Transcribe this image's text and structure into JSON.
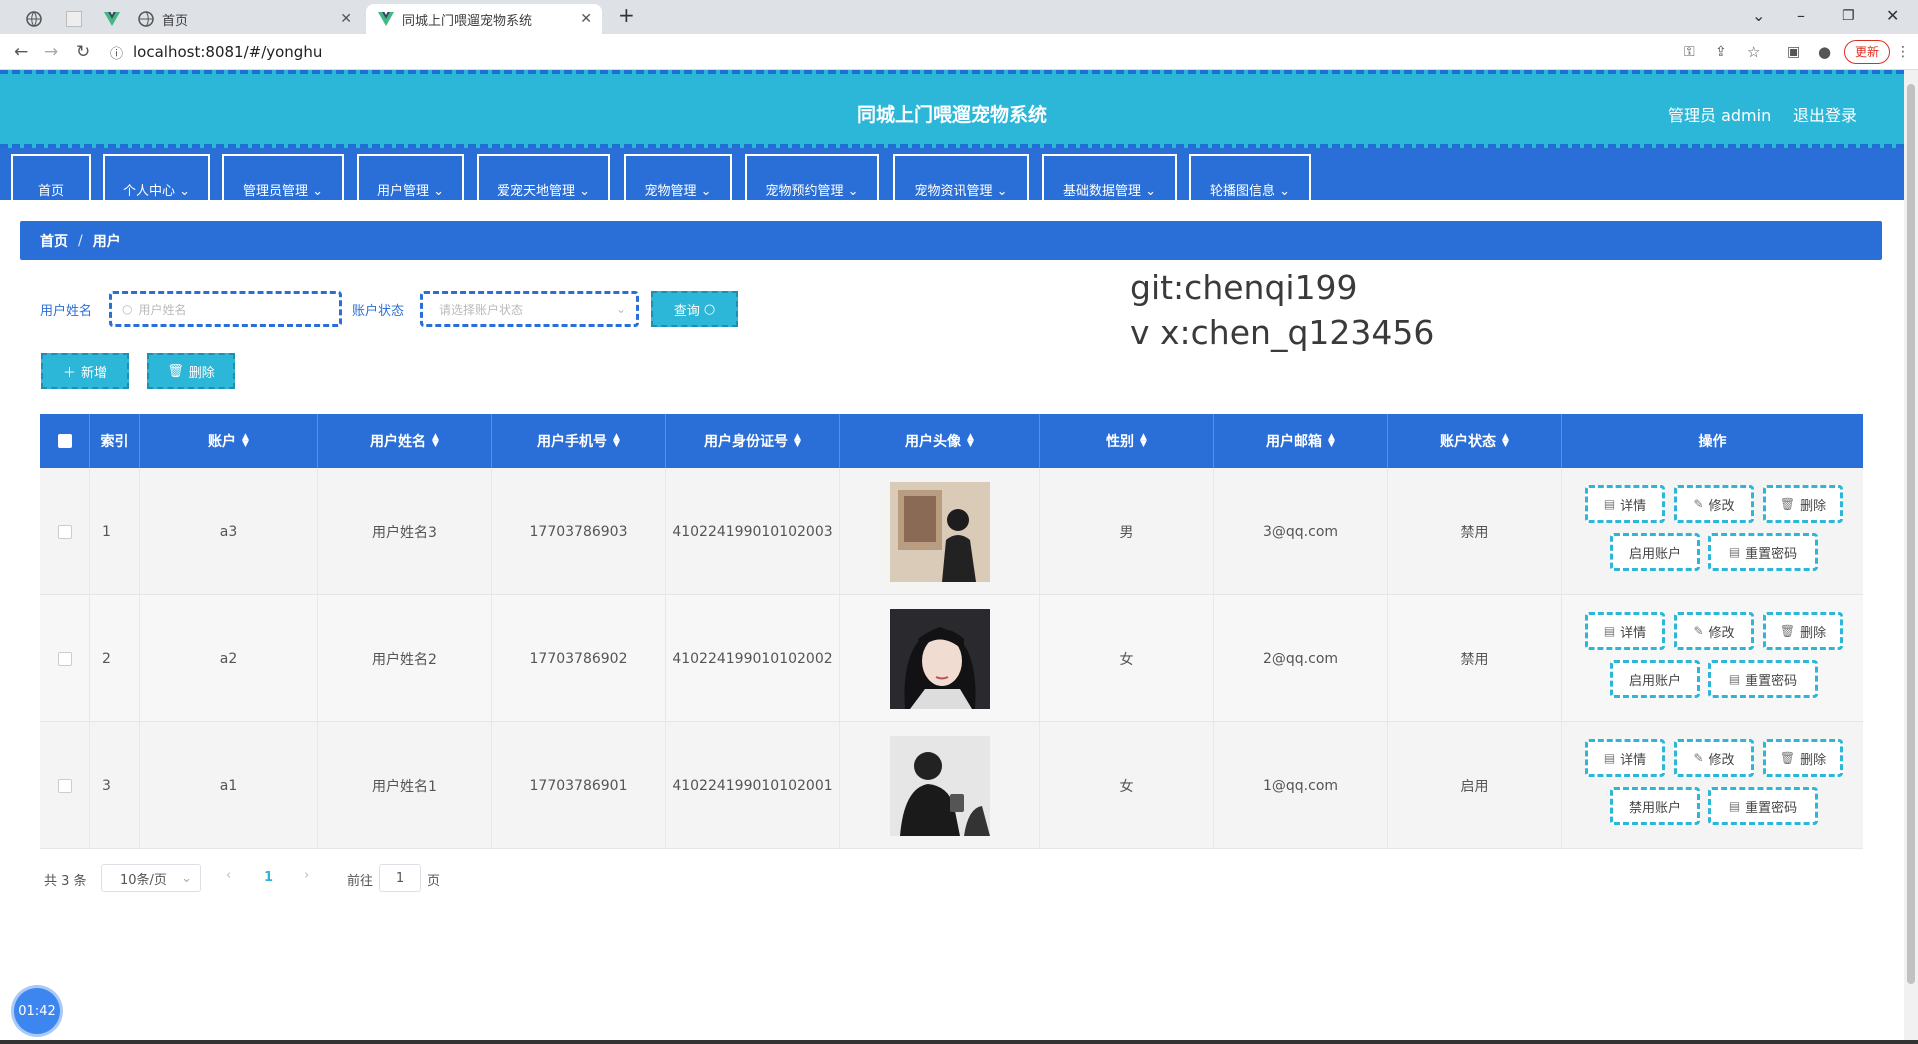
{
  "browser": {
    "tabs": [
      {
        "title": ""
      },
      {
        "title": ""
      },
      {
        "title": "首页"
      },
      {
        "title": "同城上门喂遛宠物系统"
      }
    ],
    "new_tab": "+",
    "url": "localhost:8081/#/yonghu",
    "update_label": "更新"
  },
  "header": {
    "title": "同城上门喂遛宠物系统",
    "admin_label": "管理员 admin",
    "logout_label": "退出登录"
  },
  "menu": [
    {
      "label": "首页"
    },
    {
      "label": "个人中心 ⌄"
    },
    {
      "label": "管理员管理 ⌄"
    },
    {
      "label": "用户管理 ⌄"
    },
    {
      "label": "爱宠天地管理 ⌄"
    },
    {
      "label": "宠物管理 ⌄"
    },
    {
      "label": "宠物预约管理 ⌄"
    },
    {
      "label": "宠物资讯管理 ⌄"
    },
    {
      "label": "基础数据管理 ⌄"
    },
    {
      "label": "轮播图信息 ⌄"
    }
  ],
  "breadcrumb": {
    "home": "首页",
    "separator": "/",
    "current": "用户"
  },
  "search": {
    "name_label": "用户姓名",
    "name_placeholder": "用户姓名",
    "status_label": "账户状态",
    "status_placeholder": "请选择账户状态",
    "query_label": "查询"
  },
  "actions": {
    "add_label": "新增",
    "delete_label": "删除"
  },
  "watermark": {
    "line1": "git:chenqi199",
    "line2": "v x:chen_q123456"
  },
  "table": {
    "headers": [
      "索引",
      "账户",
      "用户姓名",
      "用户手机号",
      "用户身份证号",
      "用户头像",
      "性别",
      "用户邮箱",
      "账户状态",
      "操作"
    ],
    "rows": [
      {
        "index": "1",
        "account": "a3",
        "name": "用户姓名3",
        "phone": "17703786903",
        "id_card": "410224199010102003",
        "gender": "男",
        "email": "3@qq.com",
        "status": "禁用",
        "toggle_label": "启用账户"
      },
      {
        "index": "2",
        "account": "a2",
        "name": "用户姓名2",
        "phone": "17703786902",
        "id_card": "410224199010102002",
        "gender": "女",
        "email": "2@qq.com",
        "status": "禁用",
        "toggle_label": "启用账户"
      },
      {
        "index": "3",
        "account": "a1",
        "name": "用户姓名1",
        "phone": "17703786901",
        "id_card": "410224199010102001",
        "gender": "女",
        "email": "1@qq.com",
        "status": "启用",
        "toggle_label": "禁用账户"
      }
    ],
    "op_labels": {
      "detail": "详情",
      "edit": "修改",
      "delete": "删除",
      "reset": "重置密码"
    }
  },
  "pagination": {
    "total": "共 3 条",
    "page_size": "10条/页",
    "current_page": "1",
    "goto_label": "前往",
    "goto_value": "1",
    "page_suffix": "页"
  },
  "recorder": {
    "time": "01:42"
  },
  "colors": {
    "header": "#2cb7d8",
    "menu": "#2a6fd8",
    "accent": "#2cb7d8"
  }
}
